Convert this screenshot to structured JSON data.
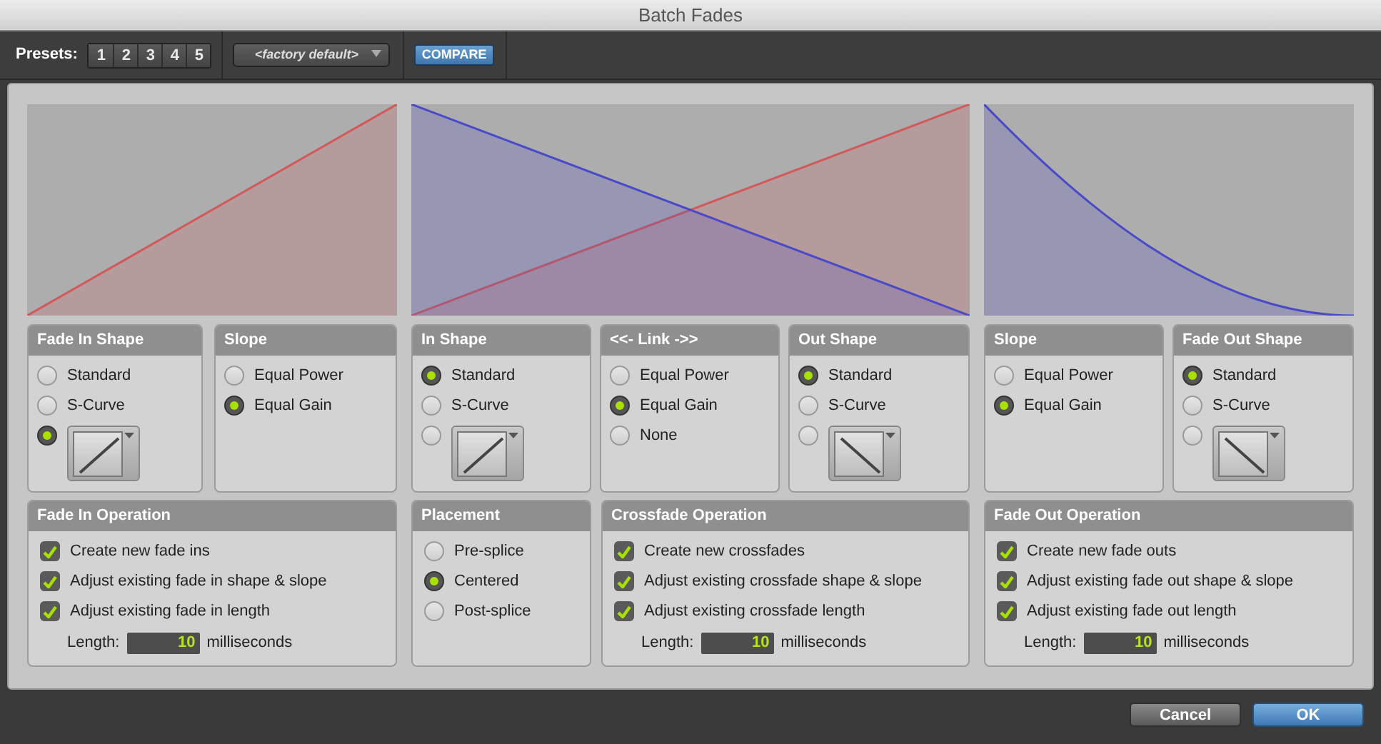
{
  "window": {
    "title": "Batch Fades"
  },
  "toolbar": {
    "presets_label": "Presets:",
    "presets": [
      {
        "label": "1"
      },
      {
        "label": "2"
      },
      {
        "label": "3"
      },
      {
        "label": "4"
      },
      {
        "label": "5"
      }
    ],
    "preset_menu": "<factory default>",
    "compare_button": "COMPARE"
  },
  "columns": [
    {
      "graph": {
        "curves": [
          {
            "kind": "linear_in",
            "color": "#d05a5a"
          }
        ]
      },
      "shape_panels": [
        {
          "title": "Fade In Shape",
          "options": [
            {
              "kind": "radio",
              "label": "Standard",
              "selected": false
            },
            {
              "kind": "radio",
              "label": "S-Curve",
              "selected": false
            },
            {
              "kind": "custom_rising",
              "selected": true
            }
          ]
        },
        {
          "title": "Slope",
          "options": [
            {
              "kind": "radio",
              "label": "Equal Power",
              "selected": false
            },
            {
              "kind": "radio",
              "label": "Equal Gain",
              "selected": true
            }
          ]
        }
      ],
      "operation_panels": [
        {
          "kind": "checklist",
          "title": "Fade In Operation",
          "items": [
            {
              "label": "Create new fade ins",
              "checked": true
            },
            {
              "label": "Adjust existing fade in shape & slope",
              "checked": true
            },
            {
              "label": "Adjust existing fade in length",
              "checked": true
            }
          ],
          "length": {
            "label": "Length:",
            "value": "10",
            "unit": "milliseconds"
          }
        }
      ]
    },
    {
      "graph": {
        "curves": [
          {
            "kind": "linear_in",
            "color": "#d05a5a"
          },
          {
            "kind": "linear_out",
            "color": "#4a4ac8"
          }
        ]
      },
      "shape_panels": [
        {
          "title": "In Shape",
          "options": [
            {
              "kind": "radio",
              "label": "Standard",
              "selected": true
            },
            {
              "kind": "radio",
              "label": "S-Curve",
              "selected": false
            },
            {
              "kind": "custom_rising",
              "selected": false
            }
          ]
        },
        {
          "title": "<<- Link ->>",
          "options": [
            {
              "kind": "radio",
              "label": "Equal Power",
              "selected": false
            },
            {
              "kind": "radio",
              "label": "Equal Gain",
              "selected": true
            },
            {
              "kind": "radio",
              "label": "None",
              "selected": false
            }
          ]
        },
        {
          "title": "Out Shape",
          "options": [
            {
              "kind": "radio",
              "label": "Standard",
              "selected": true
            },
            {
              "kind": "radio",
              "label": "S-Curve",
              "selected": false
            },
            {
              "kind": "custom_falling",
              "selected": false
            }
          ]
        }
      ],
      "operation_panels": [
        {
          "kind": "radio",
          "title": "Placement",
          "options": [
            {
              "label": "Pre-splice",
              "selected": false
            },
            {
              "label": "Centered",
              "selected": true
            },
            {
              "label": "Post-splice",
              "selected": false
            }
          ]
        },
        {
          "kind": "checklist",
          "title": "Crossfade Operation",
          "items": [
            {
              "label": "Create new crossfades",
              "checked": true
            },
            {
              "label": "Adjust existing crossfade shape & slope",
              "checked": true
            },
            {
              "label": "Adjust existing crossfade length",
              "checked": true
            }
          ],
          "length": {
            "label": "Length:",
            "value": "10",
            "unit": "milliseconds"
          }
        }
      ]
    },
    {
      "graph": {
        "curves": [
          {
            "kind": "curve_out",
            "color": "#4a4ac8"
          }
        ]
      },
      "shape_panels": [
        {
          "title": "Slope",
          "options": [
            {
              "kind": "radio",
              "label": "Equal Power",
              "selected": false
            },
            {
              "kind": "radio",
              "label": "Equal Gain",
              "selected": true
            }
          ]
        },
        {
          "title": "Fade Out Shape",
          "options": [
            {
              "kind": "radio",
              "label": "Standard",
              "selected": true
            },
            {
              "kind": "radio",
              "label": "S-Curve",
              "selected": false
            },
            {
              "kind": "custom_falling",
              "selected": false
            }
          ]
        }
      ],
      "operation_panels": [
        {
          "kind": "checklist",
          "title": "Fade Out Operation",
          "items": [
            {
              "label": "Create new fade outs",
              "checked": true
            },
            {
              "label": "Adjust existing fade out shape & slope",
              "checked": true
            },
            {
              "label": "Adjust existing fade out length",
              "checked": true
            }
          ],
          "length": {
            "label": "Length:",
            "value": "10",
            "unit": "milliseconds"
          }
        }
      ]
    }
  ],
  "buttons": [
    {
      "kind": "cancel",
      "label": "Cancel"
    },
    {
      "kind": "ok",
      "label": "OK"
    }
  ]
}
